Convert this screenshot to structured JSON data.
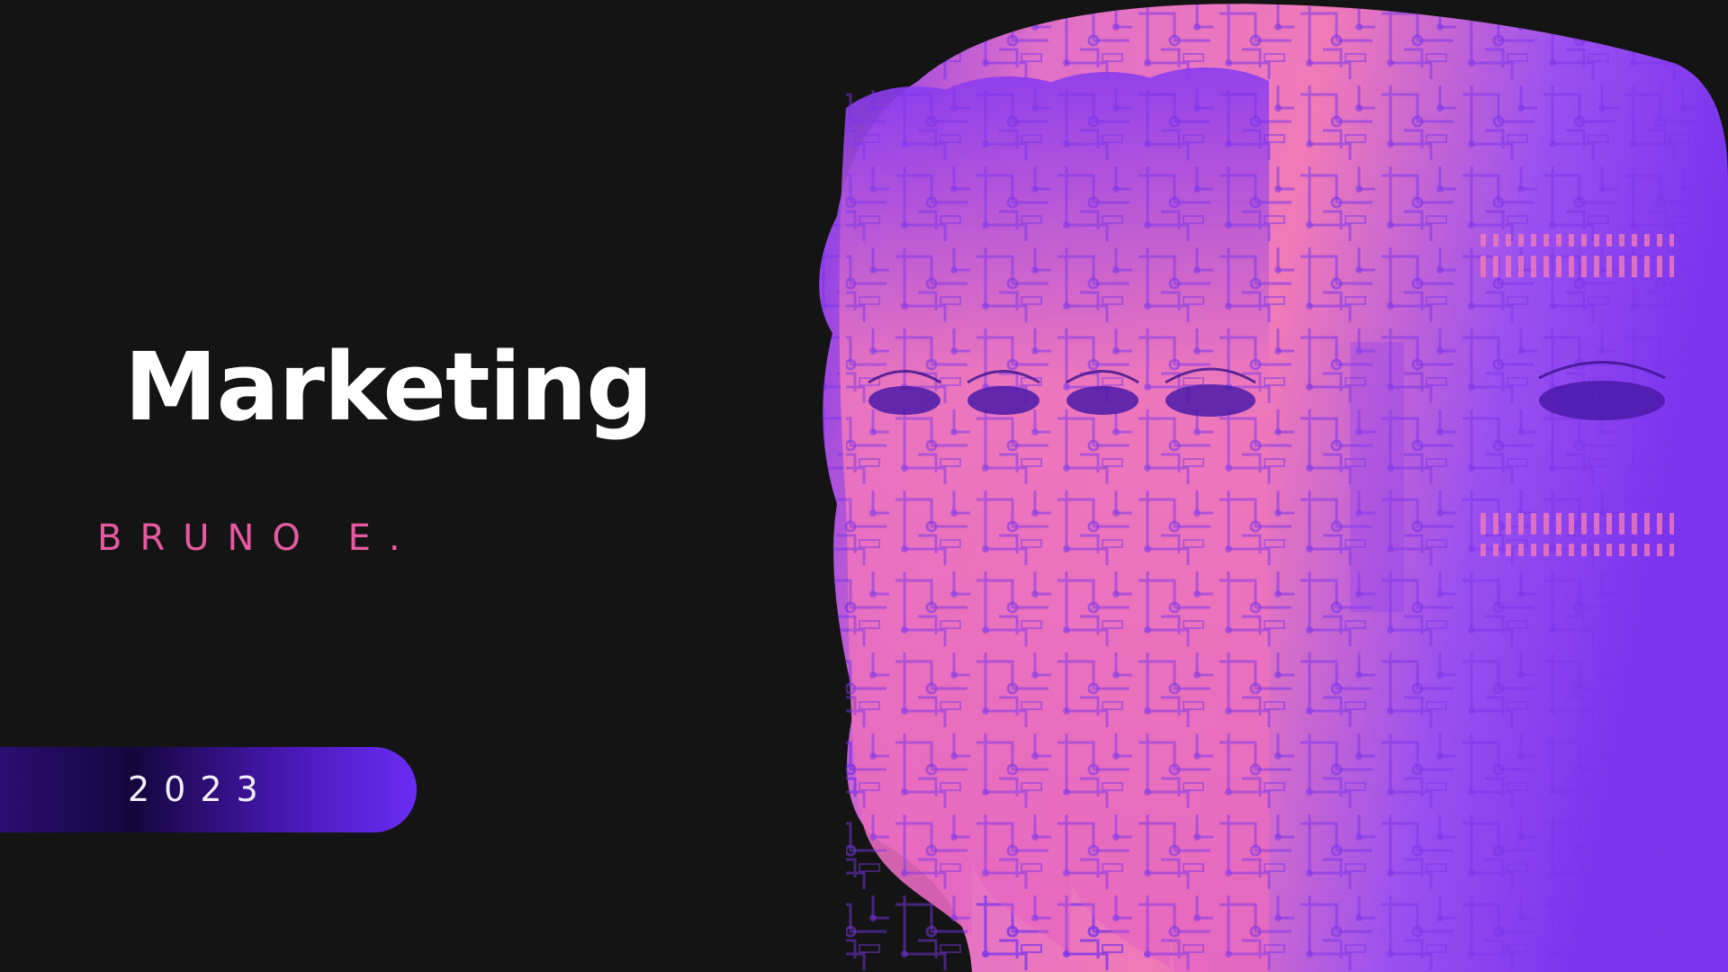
{
  "slide": {
    "title": "Marketing",
    "author": "BRUNO E.",
    "year": "2023"
  },
  "colors": {
    "background": "#141414",
    "title": "#ffffff",
    "author": "#e65aa2",
    "pill_start": "#2a0e72",
    "pill_end": "#6a2cf5",
    "art_pink": "#f06fb8",
    "art_purple": "#7a34ee"
  },
  "artwork": {
    "icon": "circuit-face-icon"
  }
}
